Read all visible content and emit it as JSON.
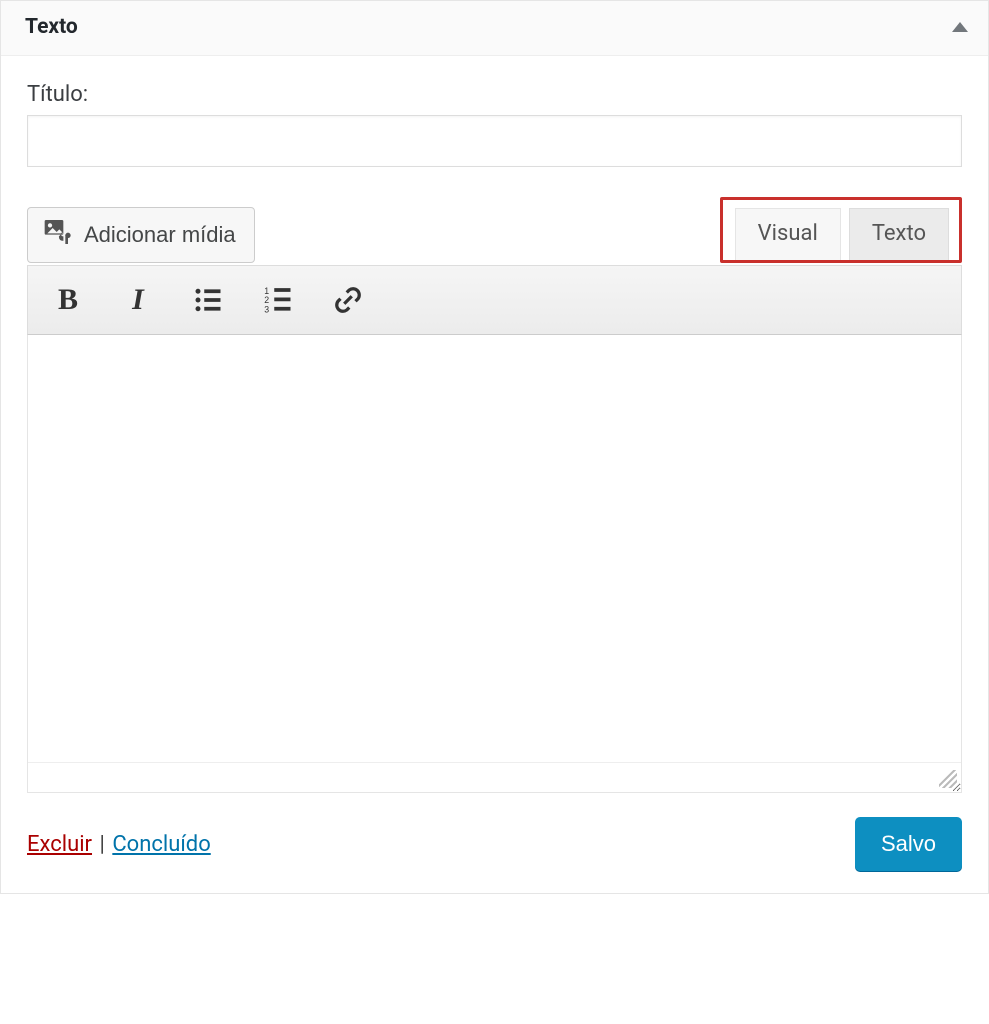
{
  "widget": {
    "title": "Texto"
  },
  "form": {
    "title_label": "Título:",
    "title_value": ""
  },
  "media_button": {
    "label": "Adicionar mídia"
  },
  "tabs": {
    "visual": "Visual",
    "text": "Texto"
  },
  "toolbar": {
    "bold": "B",
    "italic": "I"
  },
  "footer": {
    "delete": "Excluir",
    "separator": "|",
    "done": "Concluído",
    "save": "Salvo"
  }
}
